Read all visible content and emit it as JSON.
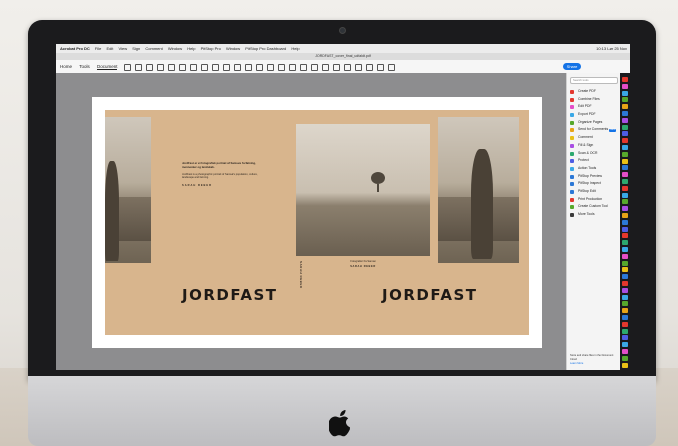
{
  "menubar": {
    "app": "Acrobat Pro DC",
    "items": [
      "File",
      "Edit",
      "View",
      "Sign",
      "Comment",
      "Window",
      "Help",
      "PitStop Pro",
      "Window",
      "PitStop Pro Dashboard",
      "Help"
    ],
    "clock": "10:13 Lør 25 Nov"
  },
  "document_title": "JORDFAST_cover_final_udfaldt.pdf",
  "toolbar": {
    "tabs": [
      "Home",
      "Tools",
      "Document"
    ],
    "active_tab": "Document",
    "share_label": "Share"
  },
  "cover": {
    "title_back": "JORDFAST",
    "title_front": "JORDFAST",
    "back_blurb_dk": "JordFast er et fotografisk portræt af Samsøs forfatning, mennesker og landskab.",
    "back_blurb_en": "JordFast is a photographic portrait of Samsø's population, culture, landscape and farming.",
    "back_author": "SARAH REBER",
    "spine_author": "SARAH REBER",
    "front_subtitle": "Fotografier fra Samsø",
    "front_author": "SARAH REBER"
  },
  "tools_panel": {
    "search_placeholder": "Search tools",
    "tools": [
      {
        "label": "Create PDF",
        "color": "#e3372e"
      },
      {
        "label": "Combine Files",
        "color": "#e3372e"
      },
      {
        "label": "Edit PDF",
        "color": "#e34ec8"
      },
      {
        "label": "Export PDF",
        "color": "#3aa8e6"
      },
      {
        "label": "Organize Pages",
        "color": "#56a82c"
      },
      {
        "label": "Send for Comments",
        "color": "#e8a317",
        "badge": "NEW"
      },
      {
        "label": "Comment",
        "color": "#e8c017"
      },
      {
        "label": "Fill & Sign",
        "color": "#a84ee3"
      },
      {
        "label": "Scan & OCR",
        "color": "#2ca86e"
      },
      {
        "label": "Protect",
        "color": "#4e5ce3"
      },
      {
        "label": "Action Tools",
        "color": "#3aa8e6"
      },
      {
        "label": "PitStop Preview",
        "color": "#2c78d6"
      },
      {
        "label": "PitStop Inspect",
        "color": "#2c78d6"
      },
      {
        "label": "PitStop Edit",
        "color": "#2c78d6"
      },
      {
        "label": "Print Production",
        "color": "#e3372e"
      },
      {
        "label": "Create Custom Tool",
        "color": "#56a82c"
      },
      {
        "label": "More Tools",
        "color": "#3a3a3a"
      }
    ],
    "footer": "Store and share files in the Document Cloud",
    "footer_link": "Learn More"
  },
  "colors": {
    "cover_tan": "#d8b58d",
    "accent_blue": "#1473e6"
  }
}
